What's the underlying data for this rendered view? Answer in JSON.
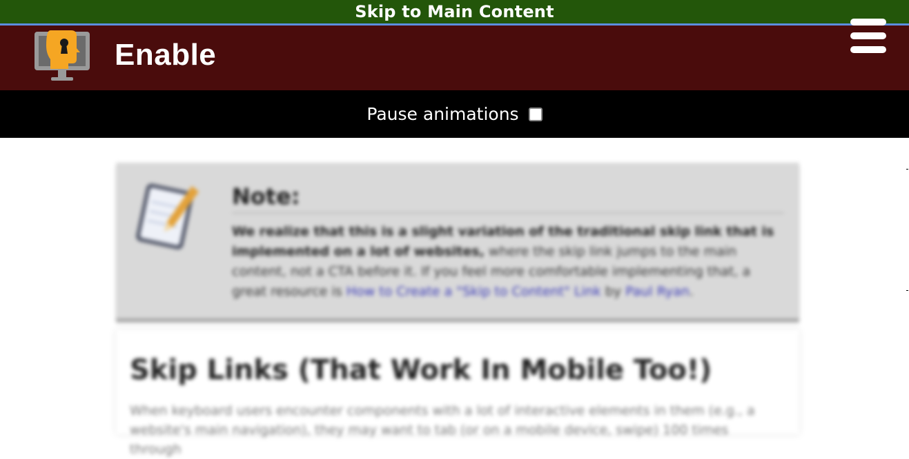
{
  "skip_link": {
    "label": "Skip to Main Content"
  },
  "header": {
    "brand": "Enable",
    "menu_icon": "hamburger-icon",
    "logo_icon": "monitor-keyhole-logo"
  },
  "pause": {
    "label": "Pause animations",
    "checked": false
  },
  "note": {
    "icon": "notepad-pencil-icon",
    "title": "Note:",
    "bold_text": "We realize that this is a slight variation of the traditional skip link that is implemented on a lot of websites,",
    "text": " where the skip link jumps to the main content, not a CTA before it. If you feel more comfortable implementing that, a great resource is ",
    "link1": "How to Create a \"Skip to Content\" Link",
    "by": " by ",
    "link2": "Paul Ryan",
    "end": "."
  },
  "article": {
    "title": "Skip Links (That Work In Mobile Too!)",
    "body": "When keyboard users encounter components with a lot of interactive elements in them (e.g., a website's main navigation), they may want to tab (or on a mobile device, swipe) 100 times through"
  },
  "colors": {
    "skip_bar": "#23560a",
    "header": "#4a0c0c",
    "pause_bar": "#000000",
    "note_bg": "#d9d9d9",
    "accent": "#f5a623"
  }
}
